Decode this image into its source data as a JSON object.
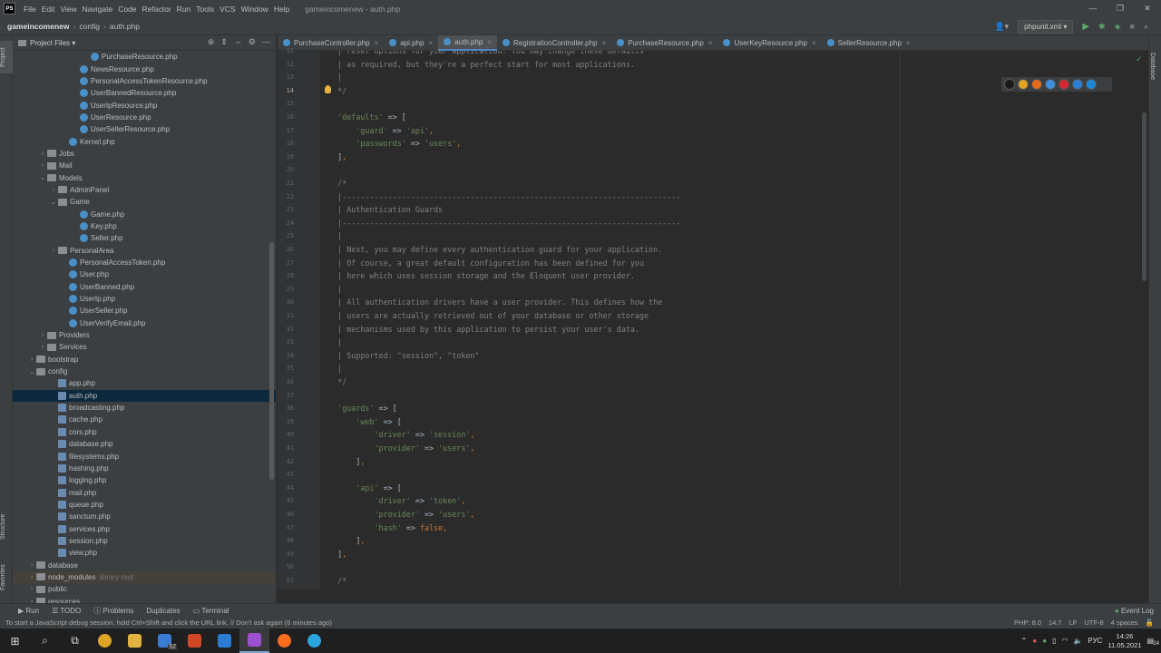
{
  "menu": {
    "items": [
      "File",
      "Edit",
      "View",
      "Navigate",
      "Code",
      "Refactor",
      "Run",
      "Tools",
      "VCS",
      "Window",
      "Help"
    ],
    "window_title": "gameincomenew - auth.php",
    "controls": [
      "—",
      "❐",
      "✕"
    ]
  },
  "nav": {
    "project": "gameincomenew",
    "folder": "config",
    "file": "auth.php",
    "run_config": "phpunit.xml"
  },
  "left_strip": {
    "project": "Project",
    "structure": "Structure",
    "favorites": "Favorites"
  },
  "right_strip": {
    "database": "Database"
  },
  "project_panel": {
    "title": "Project Files",
    "tree": [
      {
        "label": "PurchaseResource.php",
        "indent": 6,
        "kind": "php"
      },
      {
        "label": "NewsResource.php",
        "indent": 5,
        "kind": "php"
      },
      {
        "label": "PersonalAccessTokenResource.php",
        "indent": 5,
        "kind": "php"
      },
      {
        "label": "UserBannedResource.php",
        "indent": 5,
        "kind": "php"
      },
      {
        "label": "UserIpResource.php",
        "indent": 5,
        "kind": "php"
      },
      {
        "label": "UserResource.php",
        "indent": 5,
        "kind": "php"
      },
      {
        "label": "UserSellerResource.php",
        "indent": 5,
        "kind": "php"
      },
      {
        "label": "Kernel.php",
        "indent": 4,
        "kind": "php"
      },
      {
        "label": "Jobs",
        "indent": 2,
        "kind": "dir",
        "arrow": "›"
      },
      {
        "label": "Mail",
        "indent": 2,
        "kind": "dir",
        "arrow": "›"
      },
      {
        "label": "Models",
        "indent": 2,
        "kind": "dir",
        "arrow": "⌄"
      },
      {
        "label": "AdminPanel",
        "indent": 3,
        "kind": "dir",
        "arrow": "›"
      },
      {
        "label": "Game",
        "indent": 3,
        "kind": "dir",
        "arrow": "⌄"
      },
      {
        "label": "Game.php",
        "indent": 5,
        "kind": "php"
      },
      {
        "label": "Key.php",
        "indent": 5,
        "kind": "php"
      },
      {
        "label": "Seller.php",
        "indent": 5,
        "kind": "php"
      },
      {
        "label": "PersonalArea",
        "indent": 3,
        "kind": "dir",
        "arrow": "›"
      },
      {
        "label": "PersonalAccessToken.php",
        "indent": 4,
        "kind": "php"
      },
      {
        "label": "User.php",
        "indent": 4,
        "kind": "php"
      },
      {
        "label": "UserBanned.php",
        "indent": 4,
        "kind": "php"
      },
      {
        "label": "UserIp.php",
        "indent": 4,
        "kind": "php"
      },
      {
        "label": "UserSeller.php",
        "indent": 4,
        "kind": "php"
      },
      {
        "label": "UserVerifyEmail.php",
        "indent": 4,
        "kind": "php"
      },
      {
        "label": "Providers",
        "indent": 2,
        "kind": "dir",
        "arrow": "›"
      },
      {
        "label": "Services",
        "indent": 2,
        "kind": "dir",
        "arrow": "›"
      },
      {
        "label": "bootstrap",
        "indent": 1,
        "kind": "dir",
        "arrow": "›"
      },
      {
        "label": "config",
        "indent": 1,
        "kind": "dir",
        "arrow": "⌄"
      },
      {
        "label": "app.php",
        "indent": 3,
        "kind": "cfg"
      },
      {
        "label": "auth.php",
        "indent": 3,
        "kind": "cfg",
        "selected": true
      },
      {
        "label": "broadcasting.php",
        "indent": 3,
        "kind": "cfg"
      },
      {
        "label": "cache.php",
        "indent": 3,
        "kind": "cfg"
      },
      {
        "label": "cors.php",
        "indent": 3,
        "kind": "cfg"
      },
      {
        "label": "database.php",
        "indent": 3,
        "kind": "cfg"
      },
      {
        "label": "filesystems.php",
        "indent": 3,
        "kind": "cfg"
      },
      {
        "label": "hashing.php",
        "indent": 3,
        "kind": "cfg"
      },
      {
        "label": "logging.php",
        "indent": 3,
        "kind": "cfg"
      },
      {
        "label": "mail.php",
        "indent": 3,
        "kind": "cfg"
      },
      {
        "label": "queue.php",
        "indent": 3,
        "kind": "cfg"
      },
      {
        "label": "sanctum.php",
        "indent": 3,
        "kind": "cfg"
      },
      {
        "label": "services.php",
        "indent": 3,
        "kind": "cfg"
      },
      {
        "label": "session.php",
        "indent": 3,
        "kind": "cfg"
      },
      {
        "label": "view.php",
        "indent": 3,
        "kind": "cfg"
      },
      {
        "label": "database",
        "indent": 1,
        "kind": "dir",
        "arrow": "›"
      },
      {
        "label": "node_modules",
        "indent": 1,
        "kind": "dir",
        "arrow": "›",
        "note": "library root",
        "highlight": true
      },
      {
        "label": "public",
        "indent": 1,
        "kind": "dir",
        "arrow": "›"
      },
      {
        "label": "resources",
        "indent": 1,
        "kind": "dir",
        "arrow": "›"
      }
    ]
  },
  "tabs": [
    {
      "label": "PurchaseController.php"
    },
    {
      "label": "api.php"
    },
    {
      "label": "auth.php",
      "active": true
    },
    {
      "label": "RegistrationController.php"
    },
    {
      "label": "PurchaseResource.php"
    },
    {
      "label": "UserKeyResource.php"
    },
    {
      "label": "SellerResource.php"
    }
  ],
  "editor": {
    "current_line": 14,
    "lines": [
      {
        "n": "11",
        "t": "    | reset options for your application. You may change these defaults",
        "c": "cm"
      },
      {
        "n": "12",
        "t": "    | as required, but they're a perfect start for most applications.",
        "c": "cm"
      },
      {
        "n": "13",
        "t": "    |",
        "c": "cm"
      },
      {
        "n": "14",
        "t": "    */",
        "c": "cm"
      },
      {
        "n": "15",
        "t": "",
        "c": ""
      },
      {
        "n": "16",
        "t": "    'defaults' => [",
        "c": "code"
      },
      {
        "n": "17",
        "t": "        'guard' => 'api',",
        "c": "code"
      },
      {
        "n": "18",
        "t": "        'passwords' => 'users',",
        "c": "code"
      },
      {
        "n": "19",
        "t": "    ],",
        "c": "code"
      },
      {
        "n": "20",
        "t": "",
        "c": ""
      },
      {
        "n": "21",
        "t": "    /*",
        "c": "cm"
      },
      {
        "n": "22",
        "t": "    |--------------------------------------------------------------------------",
        "c": "cm"
      },
      {
        "n": "23",
        "t": "    | Authentication Guards",
        "c": "cm"
      },
      {
        "n": "24",
        "t": "    |--------------------------------------------------------------------------",
        "c": "cm"
      },
      {
        "n": "25",
        "t": "    |",
        "c": "cm"
      },
      {
        "n": "26",
        "t": "    | Next, you may define every authentication guard for your application.",
        "c": "cm"
      },
      {
        "n": "27",
        "t": "    | Of course, a great default configuration has been defined for you",
        "c": "cm"
      },
      {
        "n": "28",
        "t": "    | here which uses session storage and the Eloquent user provider.",
        "c": "cm"
      },
      {
        "n": "29",
        "t": "    |",
        "c": "cm"
      },
      {
        "n": "30",
        "t": "    | All authentication drivers have a user provider. This defines how the",
        "c": "cm"
      },
      {
        "n": "31",
        "t": "    | users are actually retrieved out of your database or other storage",
        "c": "cm"
      },
      {
        "n": "32",
        "t": "    | mechanisms used by this application to persist your user's data.",
        "c": "cm"
      },
      {
        "n": "33",
        "t": "    |",
        "c": "cm"
      },
      {
        "n": "34",
        "t": "    | Supported: \"session\", \"token\"",
        "c": "cm"
      },
      {
        "n": "35",
        "t": "    |",
        "c": "cm"
      },
      {
        "n": "36",
        "t": "    */",
        "c": "cm"
      },
      {
        "n": "37",
        "t": "",
        "c": ""
      },
      {
        "n": "38",
        "t": "    'guards' => [",
        "c": "code"
      },
      {
        "n": "39",
        "t": "        'web' => [",
        "c": "code"
      },
      {
        "n": "40",
        "t": "            'driver' => 'session',",
        "c": "code"
      },
      {
        "n": "41",
        "t": "            'provider' => 'users',",
        "c": "code"
      },
      {
        "n": "42",
        "t": "        ],",
        "c": "code"
      },
      {
        "n": "43",
        "t": "",
        "c": ""
      },
      {
        "n": "44",
        "t": "        'api' => [",
        "c": "code"
      },
      {
        "n": "45",
        "t": "            'driver' => 'token',",
        "c": "code"
      },
      {
        "n": "46",
        "t": "            'provider' => 'users',",
        "c": "code"
      },
      {
        "n": "47",
        "t": "            'hash' => false,",
        "c": "code"
      },
      {
        "n": "48",
        "t": "        ],",
        "c": "code"
      },
      {
        "n": "49",
        "t": "    ],",
        "c": "code"
      },
      {
        "n": "50",
        "t": "",
        "c": ""
      },
      {
        "n": "51",
        "t": "    /*",
        "c": "cm"
      }
    ]
  },
  "browsers": [
    {
      "name": "phpstorm-icon",
      "color": "#1a1a1a"
    },
    {
      "name": "chrome-icon",
      "color": "#e0a526"
    },
    {
      "name": "firefox-icon",
      "color": "#e66a1a"
    },
    {
      "name": "safari-icon",
      "color": "#3d8fe0"
    },
    {
      "name": "opera-icon",
      "color": "#d6262f"
    },
    {
      "name": "ie-icon",
      "color": "#2a7fd4"
    },
    {
      "name": "edge-icon",
      "color": "#1e88d6"
    }
  ],
  "bottom_tools": {
    "run": "Run",
    "todo": "TODO",
    "problems": "Problems",
    "duplicates": "Duplicates",
    "terminal": "Terminal",
    "event_log": "Event Log"
  },
  "status": {
    "message": "To start a JavaScript debug session, hold Ctrl+Shift and click the URL link. // Don't ask again (6 minutes ago)",
    "php": "PHP: 8.0",
    "pos": "14:7",
    "lf": "LF",
    "enc": "UTF-8",
    "indent": "4 spaces"
  },
  "taskbar": {
    "badge": "52",
    "lang": "РУС",
    "time": "14:26",
    "date": "11.05.2021",
    "notif": "24"
  }
}
